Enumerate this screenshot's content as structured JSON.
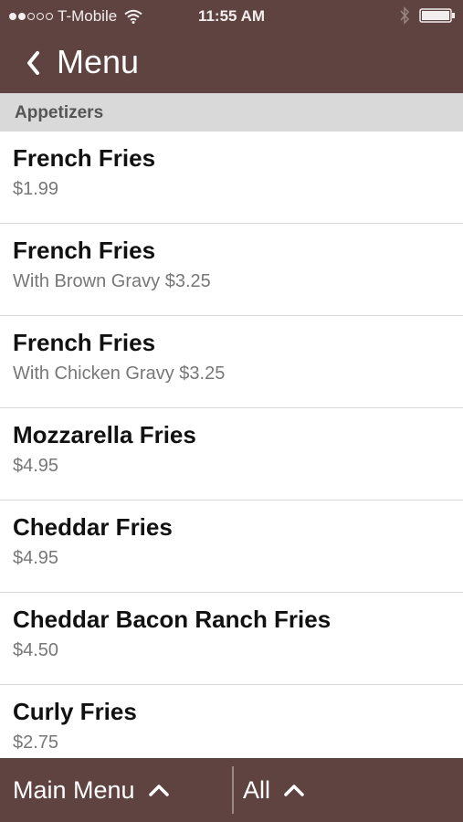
{
  "status_bar": {
    "carrier": "T-Mobile",
    "time": "11:55 AM",
    "signal_bars_filled": 2,
    "signal_bars_total": 5
  },
  "nav": {
    "title": "Menu"
  },
  "section": {
    "title": "Appetizers"
  },
  "items": [
    {
      "name": "French Fries",
      "desc": "$1.99"
    },
    {
      "name": "French Fries",
      "desc": "With Brown Gravy $3.25"
    },
    {
      "name": "French Fries",
      "desc": "With Chicken Gravy $3.25"
    },
    {
      "name": "Mozzarella Fries",
      "desc": "$4.95"
    },
    {
      "name": "Cheddar Fries",
      "desc": "$4.95"
    },
    {
      "name": "Cheddar Bacon Ranch Fries",
      "desc": "$4.50"
    },
    {
      "name": "Curly Fries",
      "desc": "$2.75"
    }
  ],
  "bottom_bar": {
    "main_menu_label": "Main Menu",
    "all_label": "All"
  },
  "colors": {
    "brand_brown": "#5f4340",
    "section_gray": "#d9d9d9"
  }
}
